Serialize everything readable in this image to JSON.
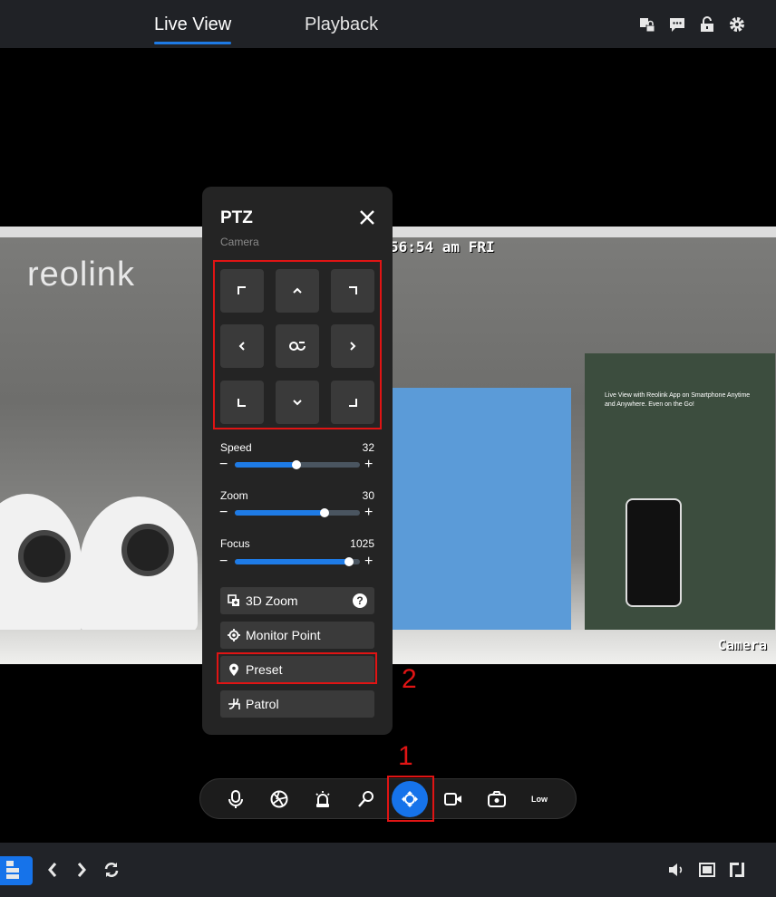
{
  "header": {
    "tabs": [
      {
        "label": "Live View",
        "active": true
      },
      {
        "label": "Playback",
        "active": false
      }
    ],
    "icons": [
      "copy-lock-icon",
      "chat-icon",
      "unlock-icon",
      "gear-icon"
    ]
  },
  "video": {
    "timestamp": "56:54 am FRI",
    "camera_label": "Camera",
    "logo": "reolink",
    "box_text": "Live View with Reolink App on Smartphone Anytime and Anywhere. Even on the Go!"
  },
  "ptz": {
    "title": "PTZ",
    "subtitle": "Camera",
    "sliders": [
      {
        "label": "Speed",
        "value": "32",
        "fraction": 0.49
      },
      {
        "label": "Zoom",
        "value": "30",
        "fraction": 0.72
      },
      {
        "label": "Focus",
        "value": "1025",
        "fraction": 0.91
      }
    ],
    "buttons": [
      {
        "label": "3D Zoom",
        "icon": "3d-zoom-icon"
      },
      {
        "label": "Monitor Point",
        "icon": "target-icon"
      },
      {
        "label": "Preset",
        "icon": "location-pin-icon"
      },
      {
        "label": "Patrol",
        "icon": "patrol-icon"
      }
    ],
    "help": "?"
  },
  "annotations": {
    "one": "1",
    "two": "2"
  },
  "toolbar": {
    "quality": "Low",
    "accent": "#1673ea"
  },
  "colors": {
    "accent": "#1e7be6",
    "highlight": "#e01414"
  }
}
